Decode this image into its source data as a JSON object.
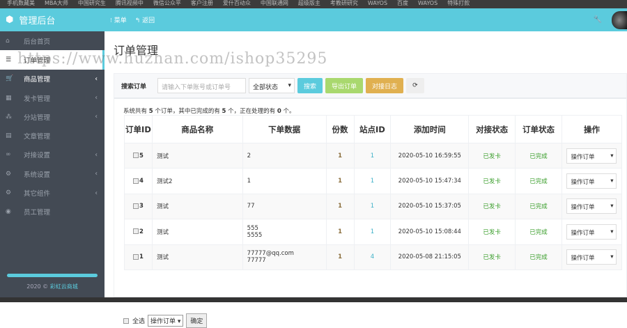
{
  "bookmarks": [
    "手机数藏美",
    "MBA大师",
    "中国研究生",
    "腾讯视频中",
    "微信公众平",
    "客户注册",
    "爱什百动众",
    "中国联通网",
    "超级版主",
    "考教研研究",
    "WAYOS",
    "百度",
    "WAYOS",
    "特殊打款"
  ],
  "header": {
    "logo": "管理后台",
    "menu": "菜单",
    "back": "返回"
  },
  "sidebar": {
    "items": [
      {
        "icon": "home-icon",
        "glyph": "⌂",
        "label": "后台首页",
        "chev": false
      },
      {
        "icon": "list-icon",
        "glyph": "☰",
        "label": "订单管理",
        "chev": false
      },
      {
        "icon": "cart-icon",
        "glyph": "🛒",
        "label": "商品管理",
        "chev": true
      },
      {
        "icon": "grid-icon",
        "glyph": "▦",
        "label": "发卡管理",
        "chev": true
      },
      {
        "icon": "sitemap-icon",
        "glyph": "⁂",
        "label": "分站管理",
        "chev": true
      },
      {
        "icon": "book-icon",
        "glyph": "▤",
        "label": "文章管理",
        "chev": false
      },
      {
        "icon": "link-icon",
        "glyph": "∞",
        "label": "对接设置",
        "chev": true
      },
      {
        "icon": "gear-icon",
        "glyph": "⚙",
        "label": "系统设置",
        "chev": true
      },
      {
        "icon": "cogs-icon",
        "glyph": "⚙",
        "label": "其它组件",
        "chev": true
      },
      {
        "icon": "user-icon",
        "glyph": "◉",
        "label": "员工管理",
        "chev": false
      }
    ],
    "footer_year": "2020 ©",
    "footer_brand": "彩虹云商城"
  },
  "page_title": "订单管理",
  "search": {
    "label": "搜索订单",
    "placeholder": "请输入下单账号或订单号",
    "status": "全部状态",
    "search_btn": "搜索",
    "export_btn": "导出订单",
    "log_btn": "对接日志"
  },
  "summary": {
    "p1": "系统共有 ",
    "total": "5",
    "p2": " 个订单，其中已完成的有 ",
    "done": "5",
    "p3": " 个，正在处理的有 ",
    "pending": "0",
    "p4": " 个。"
  },
  "table": {
    "headers": [
      "订单ID",
      "商品名称",
      "下单数据",
      "份数",
      "站点ID",
      "添加时间",
      "对接状态",
      "订单状态",
      "操作"
    ],
    "rows": [
      {
        "id": "5",
        "name": "测试",
        "data1": "2",
        "data2": "",
        "qty": "1",
        "site": "1",
        "time": "2020-05-10 16:59:55",
        "dock": "已发卡",
        "status": "已完成",
        "op": "操作订单"
      },
      {
        "id": "4",
        "name": "测试2",
        "data1": "1",
        "data2": "",
        "qty": "1",
        "site": "1",
        "time": "2020-05-10 15:47:34",
        "dock": "已发卡",
        "status": "已完成",
        "op": "操作订单"
      },
      {
        "id": "3",
        "name": "测试",
        "data1": "77",
        "data2": "",
        "qty": "1",
        "site": "1",
        "time": "2020-05-10 15:37:05",
        "dock": "已发卡",
        "status": "已完成",
        "op": "操作订单"
      },
      {
        "id": "2",
        "name": "测试",
        "data1": "555",
        "data2": "5555",
        "qty": "1",
        "site": "1",
        "time": "2020-05-10 15:08:44",
        "dock": "已发卡",
        "status": "已完成",
        "op": "操作订单"
      },
      {
        "id": "1",
        "name": "测试",
        "data1": "77777@qq.com",
        "data2": "77777",
        "qty": "1",
        "site": "4",
        "time": "2020-05-08 21:15:05",
        "dock": "已发卡",
        "status": "已完成",
        "op": "操作订单"
      }
    ]
  },
  "bottom": {
    "select_all": "全选",
    "action": "操作订单",
    "confirm": "确定"
  },
  "watermark": "https://www.huzhan.com/ishop35295"
}
